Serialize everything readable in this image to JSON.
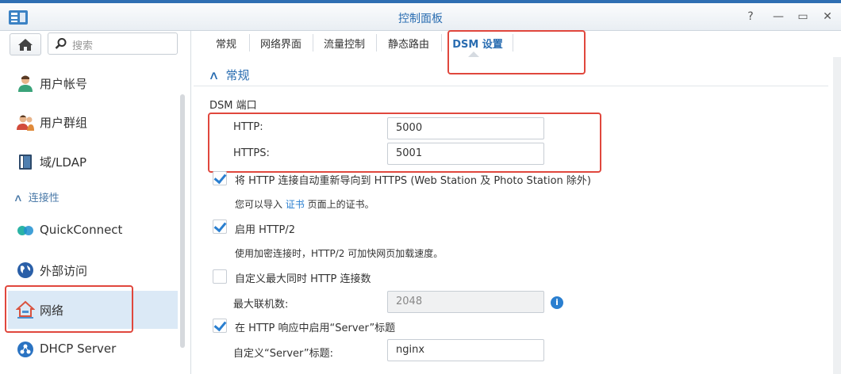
{
  "window": {
    "title": "控制面板",
    "help_icon": "help-icon",
    "min_icon": "minimize-icon",
    "max_icon": "maximize-icon",
    "close_icon": "close-icon"
  },
  "sidebar": {
    "search_placeholder": "搜索",
    "items": [
      {
        "label": "用户帐号",
        "icon": "user-icon"
      },
      {
        "label": "用户群组",
        "icon": "group-icon"
      },
      {
        "label": "域/LDAP",
        "icon": "domain-icon"
      },
      {
        "label": "QuickConnect",
        "icon": "quickconnect-icon"
      },
      {
        "label": "外部访问",
        "icon": "globe-icon"
      },
      {
        "label": "网络",
        "icon": "network-house-icon",
        "active": true
      },
      {
        "label": "DHCP Server",
        "icon": "dhcp-icon"
      }
    ],
    "section_connectivity": "连接性"
  },
  "tabs": [
    {
      "label": "常规"
    },
    {
      "label": "网络界面"
    },
    {
      "label": "流量控制"
    },
    {
      "label": "静态路由"
    },
    {
      "label": "DSM 设置",
      "active": true
    }
  ],
  "content": {
    "section_title": "常规",
    "dsm_port_label": "DSM 端口",
    "http_label": "HTTP:",
    "http_value": "5000",
    "https_label": "HTTPS:",
    "https_value": "5001",
    "redirect_label": "将 HTTP 连接自动重新导向到 HTTPS (Web Station 及 Photo Station 除外)",
    "redirect_checked": true,
    "import_note_prefix": "您可以导入 ",
    "import_note_link": "证书",
    "import_note_suffix": " 页面上的证书。",
    "http2_label": "启用 HTTP/2",
    "http2_checked": true,
    "http2_note": "使用加密连接时，HTTP/2 可加快网页加载速度。",
    "max_conn_label": "自定义最大同时 HTTP 连接数",
    "max_conn_checked": false,
    "max_conn_field_label": "最大联机数:",
    "max_conn_value": "2048",
    "server_header_label": "在 HTTP 响应中启用“Server”标题",
    "server_header_checked": true,
    "server_custom_label": "自定义“Server”标题:",
    "server_custom_value": "nginx"
  },
  "colors": {
    "accent": "#2a6db1",
    "highlight": "#e0473d",
    "active_bg": "#dbe9f6"
  }
}
